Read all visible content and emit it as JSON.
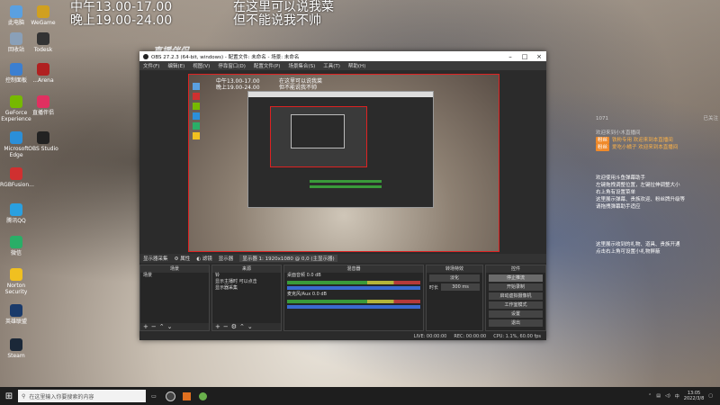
{
  "desktop": {
    "icons": [
      {
        "label": "此电脑",
        "color": "#5aa0e0"
      },
      {
        "label": "回收站",
        "color": "#8aa0b8"
      },
      {
        "label": "控制面板",
        "color": "#3c7fd0"
      },
      {
        "label": "GeForce Experience",
        "color": "#76b900"
      },
      {
        "label": "Microsoft Edge",
        "color": "#2b8fd8"
      },
      {
        "label": "RGBFusion...",
        "color": "#d03030"
      },
      {
        "label": "腾讯QQ",
        "color": "#2aa0e0"
      },
      {
        "label": "微信",
        "color": "#2aae67"
      },
      {
        "label": "Norton Security",
        "color": "#f0c020"
      },
      {
        "label": "英雄联盟",
        "color": "#1a3a6a"
      },
      {
        "label": "Steam",
        "color": "#1b2838"
      },
      {
        "label": "WeGame",
        "color": "#d0a020"
      },
      {
        "label": "Todesk",
        "color": "#333333"
      },
      {
        "label": "...Arena",
        "color": "#b02020"
      },
      {
        "label": "直播伴侣",
        "color": "#e03060"
      },
      {
        "label": "OBS Studio",
        "color": "#222222"
      }
    ]
  },
  "schedule": {
    "line1": "中午13.00-17.00",
    "line2": "晚上19.00-24.00",
    "note1": "在这里可以说我菜",
    "note2": "但不能说我不帅"
  },
  "chat": {
    "stats": [
      "已关注",
      "1071",
      "0",
      "0"
    ],
    "entries": [
      {
        "badge": "",
        "text": "欢迎来到小木直播间",
        "style": "gray"
      },
      {
        "badge": "粉丝",
        "text": "铁粉专用 欢迎来到本直播间",
        "style": "orange"
      },
      {
        "badge": "粉丝",
        "text": "爱吃小橘子 欢迎来到本直播间",
        "style": "orange"
      }
    ],
    "notice1": [
      "欢迎使用斗鱼弹幕助手",
      "左键拖拽调整位置，左键拉伸调整大小",
      "右上角有设置菜单",
      "这里展示弹幕、贵族欢迎、粉丝牌升级等",
      "请拖拽弹幕助手适应"
    ],
    "notice2": [
      "这里展示收到的礼物、道具、贵族开通",
      "点击右上角可设置小礼物屏蔽"
    ]
  },
  "obs": {
    "title": "OBS 27.2.3 (64-bit, windows) - 配置文件: 未命名 - 场景: 未命名",
    "menu": [
      "文件(F)",
      "编辑(E)",
      "视图(V)",
      "停靠窗口(D)",
      "配置文件(P)",
      "场景集合(S)",
      "工具(T)",
      "帮助(H)"
    ],
    "preview_text": {
      "l1": "中午13.00-17.00",
      "l2": "晚上19.00-24.00",
      "r1": "在这里可以说我菜",
      "r2": "但不能说我不帅"
    },
    "source_bar": [
      "显示器采集",
      "属性",
      "滤镜",
      "显示器",
      "显示器 1: 1920x1080 @ 0,0 (主显示器)"
    ],
    "docks": {
      "scenes": {
        "header": "场景",
        "items": [
          "场景"
        ]
      },
      "sources": {
        "header": "来源",
        "items": [
          "铃",
          "显示主播时 可以点击",
          "显示器采集"
        ]
      },
      "mixer": {
        "header": "混音器",
        "tracks": [
          "桌面音频 0.0 dB",
          "麦克风/Aux 0.0 dB"
        ]
      },
      "transitions": {
        "header": "转场特效",
        "type": "淡化",
        "duration_label": "时长",
        "duration": "300 ms"
      },
      "controls": {
        "header": "控件",
        "buttons": [
          "停止推流",
          "开始录制",
          "启动虚拟摄像机",
          "工作室模式",
          "设置",
          "退出"
        ]
      }
    },
    "status": [
      "LIVE: 00:00:00",
      "REC: 00:00:00",
      "CPU: 1.1%, 60.00 fps"
    ]
  },
  "taskbar": {
    "search_placeholder": "在这里输入你要搜索的内容",
    "time": "13:05",
    "date": "2022/3/8",
    "lang": "中"
  },
  "brand": {
    "logo": "直播伴侣"
  }
}
